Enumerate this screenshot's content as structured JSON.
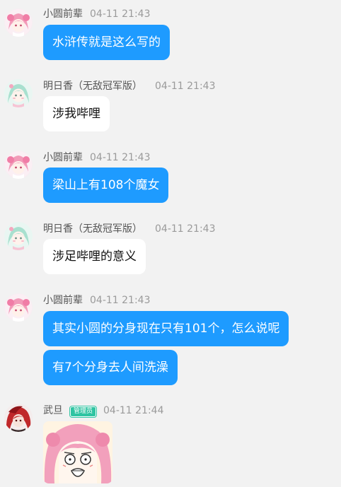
{
  "messages": [
    {
      "sender": "小圆前辈",
      "time": "04-11 21:43",
      "avatar_icon": "pink-hair-girl-avatar",
      "bubbles": [
        "水浒传就是这么写的"
      ],
      "side": "self"
    },
    {
      "sender": "明日香（无敌冠军版）",
      "time": "04-11 21:43",
      "avatar_icon": "mint-hair-girl-avatar",
      "bubbles": [
        "涉我哔哩"
      ],
      "side": "other"
    },
    {
      "sender": "小圆前辈",
      "time": "04-11 21:43",
      "avatar_icon": "pink-hair-girl-avatar",
      "bubbles": [
        "梁山上有108个魔女"
      ],
      "side": "self"
    },
    {
      "sender": "明日香（无敌冠军版）",
      "time": "04-11 21:43",
      "avatar_icon": "mint-hair-girl-avatar",
      "bubbles": [
        "涉足哔哩的意义"
      ],
      "side": "other"
    },
    {
      "sender": "小圆前辈",
      "time": "04-11 21:43",
      "avatar_icon": "pink-hair-girl-avatar",
      "bubbles": [
        "其实小圆的分身现在只有101个，怎么说呢",
        "有7个分身去人间洗澡"
      ],
      "side": "self"
    },
    {
      "sender": "武旦",
      "badge": "管理员",
      "time": "04-11 21:44",
      "avatar_icon": "red-hair-character-avatar",
      "sticker_icon": "shocked-pink-hair-girl-sticker"
    }
  ],
  "colors": {
    "self_bubble": "#1e9bff",
    "other_bubble": "#ffffff",
    "admin_badge": "#2fc4a2",
    "background": "#f2f2f2"
  }
}
